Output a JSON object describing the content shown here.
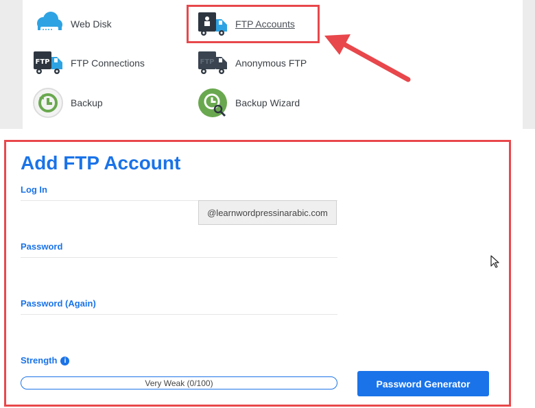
{
  "top_items": [
    {
      "label": "Web Disk",
      "icon": "cloud-disk-icon"
    },
    {
      "label": "FTP Accounts",
      "icon": "ftp-accounts-icon"
    },
    {
      "label": "FTP Connections",
      "icon": "ftp-connections-icon"
    },
    {
      "label": "Anonymous FTP",
      "icon": "anonymous-ftp-icon"
    },
    {
      "label": "Backup",
      "icon": "backup-icon"
    },
    {
      "label": "Backup Wizard",
      "icon": "backup-wizard-icon"
    }
  ],
  "form": {
    "title": "Add FTP Account",
    "login_label": "Log In",
    "login_value": "",
    "domain_suffix": "@learnwordpressinarabic.com",
    "password_label": "Password",
    "password_value": "",
    "password_again_label": "Password (Again)",
    "password_again_value": "",
    "strength_label": "Strength",
    "strength_info_glyph": "i",
    "strength_text": "Very Weak (0/100)",
    "strength_value": 0,
    "generator_label": "Password Generator"
  },
  "colors": {
    "accent": "#1a73e8",
    "highlight": "#e8474b"
  }
}
